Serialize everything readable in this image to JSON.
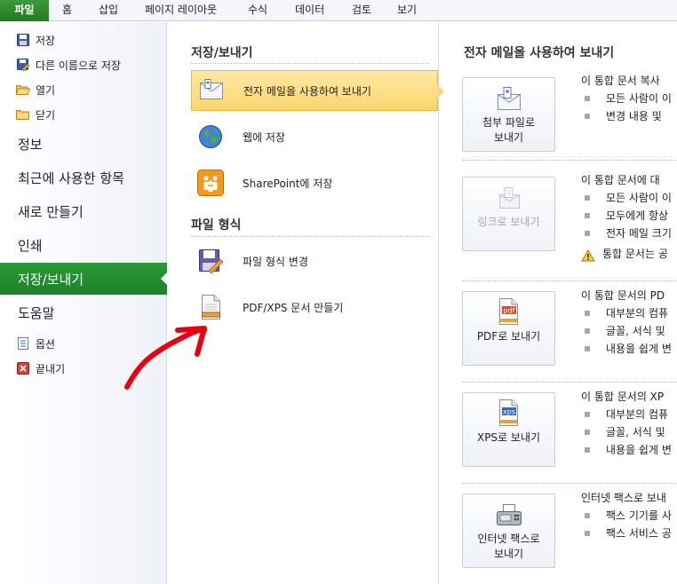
{
  "ribbon": {
    "tabs": [
      "파일",
      "홈",
      "삽입",
      "페이지 레이아웃",
      "수식",
      "데이터",
      "검토",
      "보기"
    ]
  },
  "sidebar": {
    "small_top": [
      {
        "label": "저장",
        "icon": "save-icon"
      },
      {
        "label": "다른 이름으로 저장",
        "icon": "save-as-icon"
      },
      {
        "label": "열기",
        "icon": "open-folder-icon"
      },
      {
        "label": "닫기",
        "icon": "close-folder-icon"
      }
    ],
    "big": [
      {
        "label": "정보"
      },
      {
        "label": "최근에 사용한 항목"
      },
      {
        "label": "새로 만들기"
      },
      {
        "label": "인쇄"
      },
      {
        "label": "저장/보내기"
      },
      {
        "label": "도움말"
      }
    ],
    "small_bottom": [
      {
        "label": "옵션",
        "icon": "options-icon"
      },
      {
        "label": "끝내기",
        "icon": "exit-icon"
      }
    ]
  },
  "middle": {
    "section1_title": "저장/보내기",
    "section1_items": [
      {
        "label": "전자 메일을 사용하여 보내기",
        "icon": "email-icon"
      },
      {
        "label": "웹에 저장",
        "icon": "globe-icon"
      },
      {
        "label": "SharePoint에 저장",
        "icon": "sharepoint-icon"
      }
    ],
    "section2_title": "파일 형식",
    "section2_items": [
      {
        "label": "파일 형식 변경",
        "icon": "change-file-type-icon"
      },
      {
        "label": "PDF/XPS 문서 만들기",
        "icon": "pdf-xps-document-icon"
      }
    ]
  },
  "right": {
    "title": "전자 메일을 사용하여 보내기",
    "options": [
      {
        "button_line1": "첨부 파일로",
        "button_line2": "보내기",
        "icon": "attachment-icon",
        "disabled": false,
        "head": "이 통합 문서 복사",
        "bullets": [
          "모든 사람이 이",
          "변경 내용 및"
        ],
        "warning": ""
      },
      {
        "button_line1": "링크로 보내기",
        "button_line2": "",
        "icon": "link-icon",
        "disabled": true,
        "head": "이 통합 문서에 대",
        "bullets": [
          "모든 사람이 이",
          "모두에게 항상",
          "전자 메일 크기"
        ],
        "warning": "통합 문서는 공"
      },
      {
        "button_line1": "PDF로 보내기",
        "button_line2": "",
        "icon": "pdf-icon",
        "icon_text": "pdf",
        "disabled": false,
        "head": "이 통합 문서의 PD",
        "bullets": [
          "대부분의 컴퓨",
          "글꼴, 서식 및",
          "내용을 쉽게 변"
        ],
        "warning": ""
      },
      {
        "button_line1": "XPS로 보내기",
        "button_line2": "",
        "icon": "xps-icon",
        "icon_text": "xps",
        "disabled": false,
        "head": "이 통합 문서의 XP",
        "bullets": [
          "대부분의 컴퓨",
          "글꼴, 서식 및",
          "내용을 쉽게 변"
        ],
        "warning": ""
      },
      {
        "button_line1": "인터넷 팩스로",
        "button_line2": "보내기",
        "icon": "fax-icon",
        "disabled": false,
        "head": "인터넷 팩스로 보내",
        "bullets": [
          "팩스 기기를 사",
          "팩스 서비스 공"
        ],
        "warning": ""
      }
    ]
  },
  "colors": {
    "file_tab": "#217a1e",
    "active_sidebar": "#1d8029",
    "selected_item": "#fbd66b",
    "annotation_arrow": "#e8000f"
  }
}
